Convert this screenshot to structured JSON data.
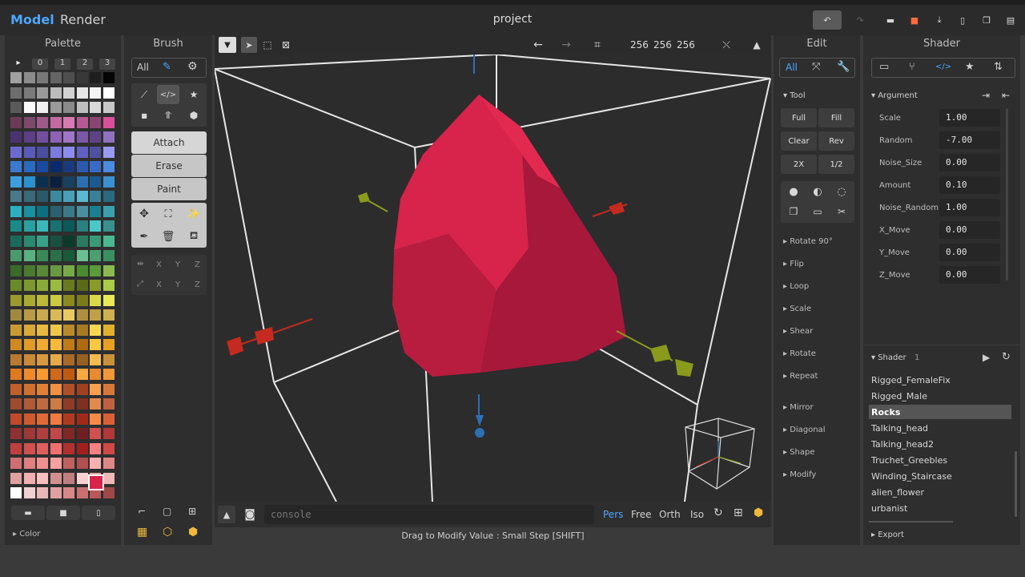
{
  "modes": {
    "model": "Model",
    "render": "Render"
  },
  "title": "project",
  "palette": {
    "title": "Palette",
    "tabs": [
      "▸",
      "0",
      "1",
      "2",
      "3"
    ],
    "color_label": "Color"
  },
  "brush": {
    "title": "Brush",
    "all": "All",
    "attach": "Attach",
    "erase": "Erase",
    "paint": "Paint",
    "axes": [
      "X",
      "Y",
      "Z"
    ]
  },
  "viewport": {
    "size_x": "256",
    "size_y": "256",
    "size_z": "256",
    "console_placeholder": "console",
    "views": [
      "Pers",
      "Free",
      "Orth",
      "Iso"
    ],
    "status": "Drag to Modify Value : Small Step [SHIFT]"
  },
  "edit": {
    "title": "Edit",
    "all": "All",
    "tool_label": "Tool",
    "tool_buttons": [
      "Full",
      "Fill",
      "Clear",
      "Rev",
      "2X",
      "1/2"
    ],
    "sections": [
      "Rotate 90°",
      "Flip",
      "Loop",
      "Scale",
      "Shear",
      "Rotate",
      "Repeat",
      "Mirror",
      "Diagonal",
      "Shape",
      "Modify"
    ]
  },
  "shader": {
    "title": "Shader",
    "argument_label": "Argument",
    "arguments": [
      {
        "name": "Scale",
        "value": "1.00"
      },
      {
        "name": "Random",
        "value": "-7.00"
      },
      {
        "name": "Noise_Size",
        "value": "0.00"
      },
      {
        "name": "Amount",
        "value": "0.10"
      },
      {
        "name": "Noise_Random",
        "value": "1.00"
      },
      {
        "name": "X_Move",
        "value": "0.00"
      },
      {
        "name": "Y_Move",
        "value": "0.00"
      },
      {
        "name": "Z_Move",
        "value": "0.00"
      }
    ],
    "list_label": "Shader",
    "list_count": "1",
    "list": [
      "Rigged_FemaleFix",
      "Rigged_Male",
      "Rocks",
      "Talking_head",
      "Talking_head2",
      "Truchet_Greebles",
      "Winding_Staircase",
      "alien_flower",
      "urbanist"
    ],
    "selected": "Rocks",
    "export_label": "Export"
  },
  "colors": {
    "accent": "#4da6ff",
    "selected_voxel": "#d8234a",
    "save": "#ff6a3d"
  }
}
